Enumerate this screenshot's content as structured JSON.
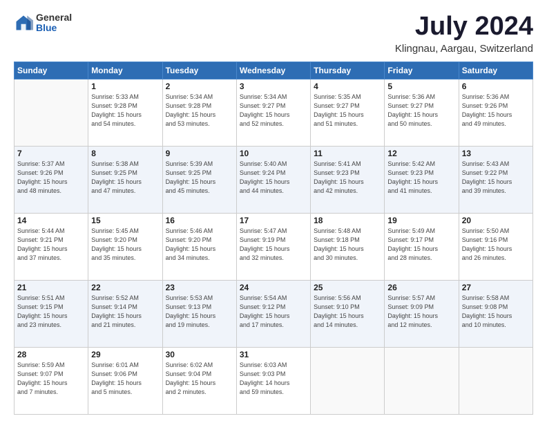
{
  "header": {
    "logo_general": "General",
    "logo_blue": "Blue",
    "month_title": "July 2024",
    "location": "Klingnau, Aargau, Switzerland"
  },
  "weekdays": [
    "Sunday",
    "Monday",
    "Tuesday",
    "Wednesday",
    "Thursday",
    "Friday",
    "Saturday"
  ],
  "weeks": [
    [
      {
        "day": "",
        "info": ""
      },
      {
        "day": "1",
        "info": "Sunrise: 5:33 AM\nSunset: 9:28 PM\nDaylight: 15 hours\nand 54 minutes."
      },
      {
        "day": "2",
        "info": "Sunrise: 5:34 AM\nSunset: 9:28 PM\nDaylight: 15 hours\nand 53 minutes."
      },
      {
        "day": "3",
        "info": "Sunrise: 5:34 AM\nSunset: 9:27 PM\nDaylight: 15 hours\nand 52 minutes."
      },
      {
        "day": "4",
        "info": "Sunrise: 5:35 AM\nSunset: 9:27 PM\nDaylight: 15 hours\nand 51 minutes."
      },
      {
        "day": "5",
        "info": "Sunrise: 5:36 AM\nSunset: 9:27 PM\nDaylight: 15 hours\nand 50 minutes."
      },
      {
        "day": "6",
        "info": "Sunrise: 5:36 AM\nSunset: 9:26 PM\nDaylight: 15 hours\nand 49 minutes."
      }
    ],
    [
      {
        "day": "7",
        "info": "Sunrise: 5:37 AM\nSunset: 9:26 PM\nDaylight: 15 hours\nand 48 minutes."
      },
      {
        "day": "8",
        "info": "Sunrise: 5:38 AM\nSunset: 9:25 PM\nDaylight: 15 hours\nand 47 minutes."
      },
      {
        "day": "9",
        "info": "Sunrise: 5:39 AM\nSunset: 9:25 PM\nDaylight: 15 hours\nand 45 minutes."
      },
      {
        "day": "10",
        "info": "Sunrise: 5:40 AM\nSunset: 9:24 PM\nDaylight: 15 hours\nand 44 minutes."
      },
      {
        "day": "11",
        "info": "Sunrise: 5:41 AM\nSunset: 9:23 PM\nDaylight: 15 hours\nand 42 minutes."
      },
      {
        "day": "12",
        "info": "Sunrise: 5:42 AM\nSunset: 9:23 PM\nDaylight: 15 hours\nand 41 minutes."
      },
      {
        "day": "13",
        "info": "Sunrise: 5:43 AM\nSunset: 9:22 PM\nDaylight: 15 hours\nand 39 minutes."
      }
    ],
    [
      {
        "day": "14",
        "info": "Sunrise: 5:44 AM\nSunset: 9:21 PM\nDaylight: 15 hours\nand 37 minutes."
      },
      {
        "day": "15",
        "info": "Sunrise: 5:45 AM\nSunset: 9:20 PM\nDaylight: 15 hours\nand 35 minutes."
      },
      {
        "day": "16",
        "info": "Sunrise: 5:46 AM\nSunset: 9:20 PM\nDaylight: 15 hours\nand 34 minutes."
      },
      {
        "day": "17",
        "info": "Sunrise: 5:47 AM\nSunset: 9:19 PM\nDaylight: 15 hours\nand 32 minutes."
      },
      {
        "day": "18",
        "info": "Sunrise: 5:48 AM\nSunset: 9:18 PM\nDaylight: 15 hours\nand 30 minutes."
      },
      {
        "day": "19",
        "info": "Sunrise: 5:49 AM\nSunset: 9:17 PM\nDaylight: 15 hours\nand 28 minutes."
      },
      {
        "day": "20",
        "info": "Sunrise: 5:50 AM\nSunset: 9:16 PM\nDaylight: 15 hours\nand 26 minutes."
      }
    ],
    [
      {
        "day": "21",
        "info": "Sunrise: 5:51 AM\nSunset: 9:15 PM\nDaylight: 15 hours\nand 23 minutes."
      },
      {
        "day": "22",
        "info": "Sunrise: 5:52 AM\nSunset: 9:14 PM\nDaylight: 15 hours\nand 21 minutes."
      },
      {
        "day": "23",
        "info": "Sunrise: 5:53 AM\nSunset: 9:13 PM\nDaylight: 15 hours\nand 19 minutes."
      },
      {
        "day": "24",
        "info": "Sunrise: 5:54 AM\nSunset: 9:12 PM\nDaylight: 15 hours\nand 17 minutes."
      },
      {
        "day": "25",
        "info": "Sunrise: 5:56 AM\nSunset: 9:10 PM\nDaylight: 15 hours\nand 14 minutes."
      },
      {
        "day": "26",
        "info": "Sunrise: 5:57 AM\nSunset: 9:09 PM\nDaylight: 15 hours\nand 12 minutes."
      },
      {
        "day": "27",
        "info": "Sunrise: 5:58 AM\nSunset: 9:08 PM\nDaylight: 15 hours\nand 10 minutes."
      }
    ],
    [
      {
        "day": "28",
        "info": "Sunrise: 5:59 AM\nSunset: 9:07 PM\nDaylight: 15 hours\nand 7 minutes."
      },
      {
        "day": "29",
        "info": "Sunrise: 6:01 AM\nSunset: 9:06 PM\nDaylight: 15 hours\nand 5 minutes."
      },
      {
        "day": "30",
        "info": "Sunrise: 6:02 AM\nSunset: 9:04 PM\nDaylight: 15 hours\nand 2 minutes."
      },
      {
        "day": "31",
        "info": "Sunrise: 6:03 AM\nSunset: 9:03 PM\nDaylight: 14 hours\nand 59 minutes."
      },
      {
        "day": "",
        "info": ""
      },
      {
        "day": "",
        "info": ""
      },
      {
        "day": "",
        "info": ""
      }
    ]
  ]
}
